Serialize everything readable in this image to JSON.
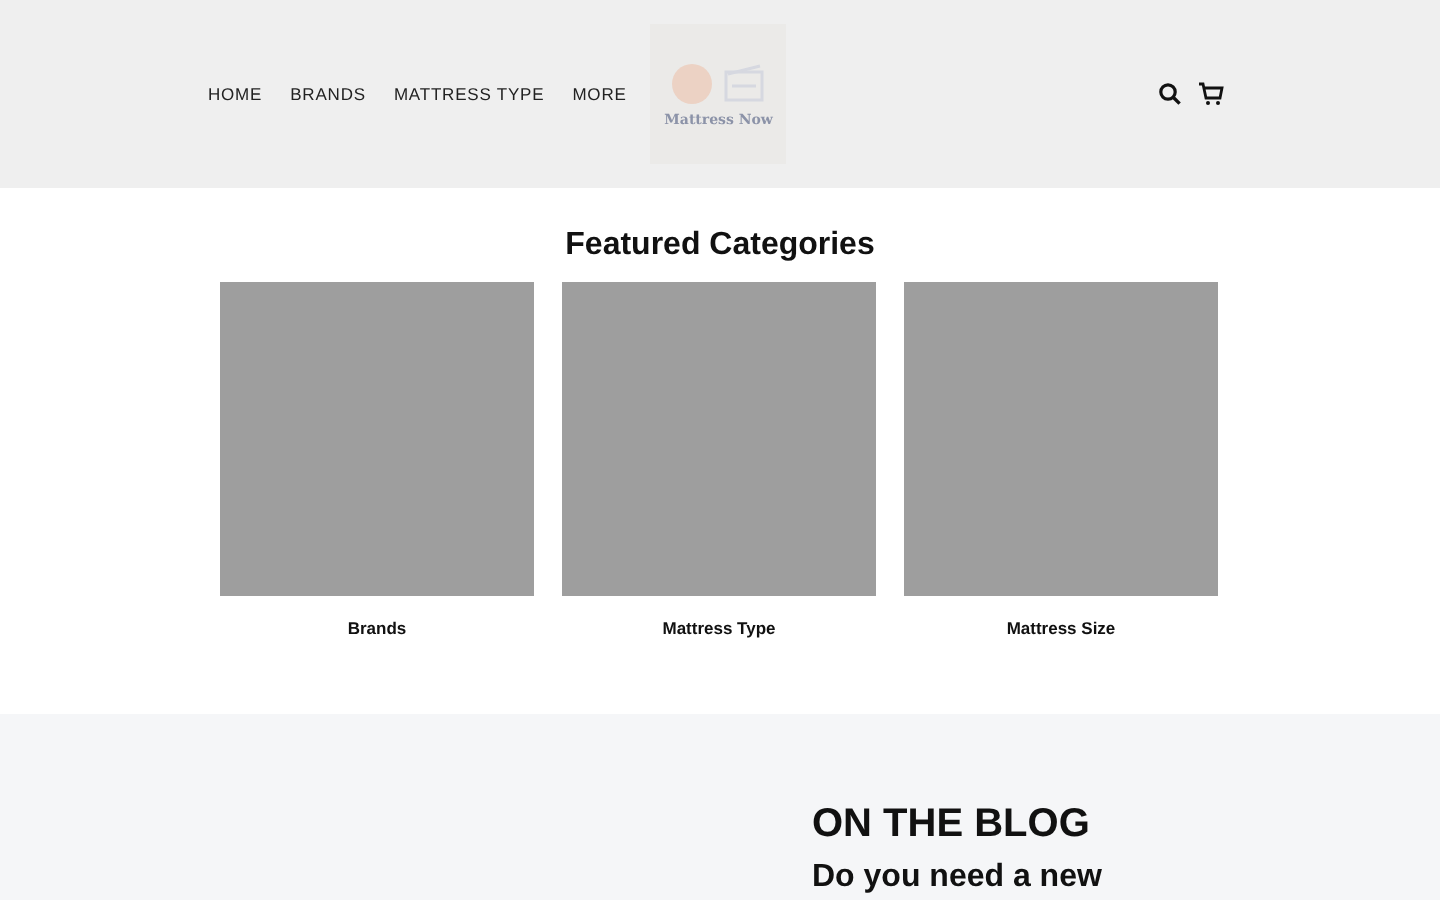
{
  "nav": {
    "items": [
      "HOME",
      "BRANDS",
      "MATTRESS TYPE",
      "MORE"
    ]
  },
  "logo": {
    "text": "Mattress Now"
  },
  "featured": {
    "title": "Featured Categories",
    "categories": [
      {
        "label": "Brands"
      },
      {
        "label": "Mattress Type"
      },
      {
        "label": "Mattress Size"
      }
    ]
  },
  "blog": {
    "title": "ON THE BLOG",
    "post_title": "Do you need a new"
  }
}
